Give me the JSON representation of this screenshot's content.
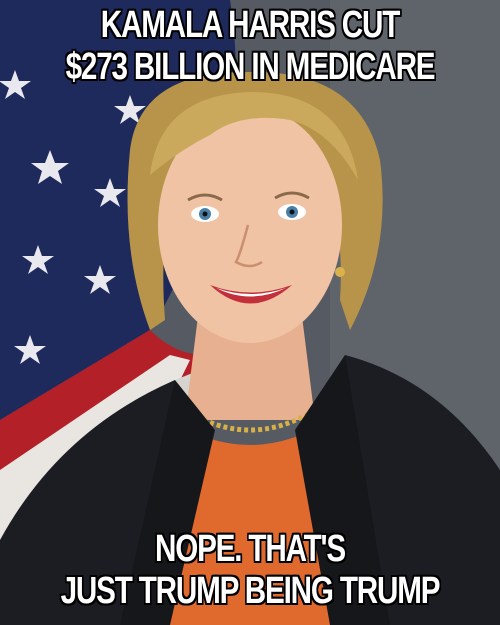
{
  "meme": {
    "top_text": [
      "KAMALA HARRIS CUT",
      "$273 BILLION IN MEDICARE"
    ],
    "bottom_text": [
      "NOPE. THAT'S",
      "JUST TRUMP BEING TRUMP"
    ]
  },
  "colors": {
    "caption_fill": "#ffffff",
    "caption_outline": "#000000",
    "flag_blue": "#1e2a5c",
    "flag_red": "#b32028",
    "backdrop": "#565b63",
    "jacket": "#15171b",
    "top_shirt": "#e06a2e",
    "hair": "#c9a85a"
  },
  "image": {
    "subject": "smiling-woman-portrait",
    "background": "american-flag"
  }
}
